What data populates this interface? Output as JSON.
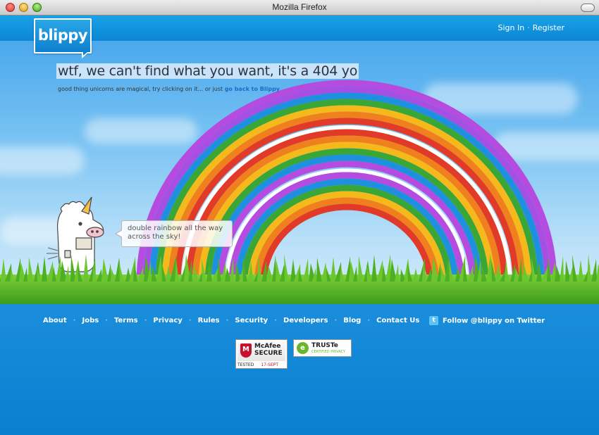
{
  "window": {
    "title": "Mozilla Firefox"
  },
  "header": {
    "logo": "blippy",
    "sign_in": "Sign In",
    "register": "Register",
    "separator": "·"
  },
  "main": {
    "headline": "wtf, we can't find what you want, it's a 404 yo",
    "subtext": "good thing unicorns are magical, try clicking on it... or just ",
    "back_link": "go back to Blippy",
    "speech": "double rainbow all the way across the sky!"
  },
  "footer": {
    "nav": [
      "About",
      "Jobs",
      "Terms",
      "Privacy",
      "Rules",
      "Security",
      "Developers",
      "Blog",
      "Contact Us"
    ],
    "separator": "·",
    "twitter_label": "Follow @blippy on Twitter",
    "mcafee": {
      "brand": "McAfee",
      "line2": "SECURE",
      "tested": "TESTED",
      "date": "17-SEPT"
    },
    "truste": {
      "brand": "TRUSTe",
      "sub": "CERTIFIED PRIVACY"
    }
  },
  "colors": {
    "header_blue": "#0b86d4",
    "footer_blue": "#0a7fd0",
    "link_blue": "#1a6fc0",
    "rainbow": [
      "#b64bdf",
      "#1f90e0",
      "#3aa636",
      "#f6b91c",
      "#f07f1d",
      "#e23a28"
    ]
  }
}
